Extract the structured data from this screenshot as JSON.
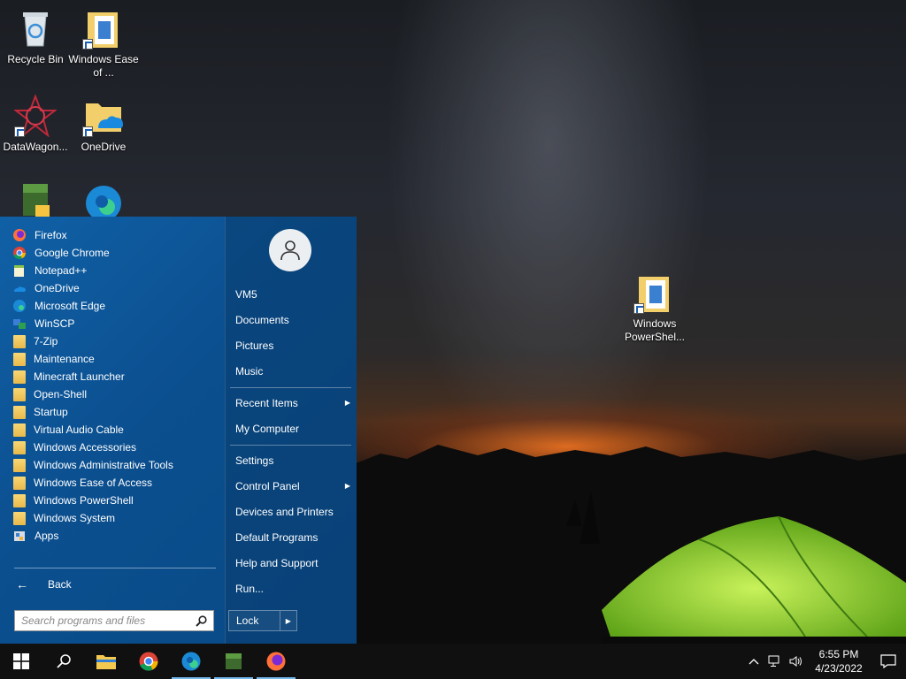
{
  "desktop": {
    "icons": [
      {
        "label": "Recycle Bin",
        "icon": "recycle-bin-icon"
      },
      {
        "label": "Windows Ease of ...",
        "icon": "folder-shortcut-icon"
      },
      {
        "label": "DataWagon...",
        "icon": "datawagon-icon"
      },
      {
        "label": "OneDrive",
        "icon": "onedrive-folder-icon"
      },
      {
        "label": "Windows PowerShel...",
        "icon": "folder-shortcut-icon"
      }
    ]
  },
  "start_menu": {
    "programs": [
      {
        "label": "Firefox",
        "icon": "firefox-icon"
      },
      {
        "label": "Google Chrome",
        "icon": "chrome-icon"
      },
      {
        "label": "Notepad++",
        "icon": "notepadpp-icon"
      },
      {
        "label": "OneDrive",
        "icon": "onedrive-icon"
      },
      {
        "label": "Microsoft Edge",
        "icon": "edge-icon"
      },
      {
        "label": "WinSCP",
        "icon": "winscp-icon"
      },
      {
        "label": "7-Zip",
        "icon": "folder-icon"
      },
      {
        "label": "Maintenance",
        "icon": "folder-icon"
      },
      {
        "label": "Minecraft Launcher",
        "icon": "folder-icon"
      },
      {
        "label": "Open-Shell",
        "icon": "folder-icon"
      },
      {
        "label": "Startup",
        "icon": "folder-icon"
      },
      {
        "label": "Virtual Audio Cable",
        "icon": "folder-icon"
      },
      {
        "label": "Windows Accessories",
        "icon": "folder-icon"
      },
      {
        "label": "Windows Administrative Tools",
        "icon": "folder-icon"
      },
      {
        "label": "Windows Ease of Access",
        "icon": "folder-icon"
      },
      {
        "label": "Windows PowerShell",
        "icon": "folder-icon"
      },
      {
        "label": "Windows System",
        "icon": "folder-icon"
      },
      {
        "label": "Apps",
        "icon": "apps-icon"
      }
    ],
    "back_label": "Back",
    "search_placeholder": "Search programs and files",
    "right": {
      "user": "VM5",
      "documents": "Documents",
      "pictures": "Pictures",
      "music": "Music",
      "recent_items": "Recent Items",
      "my_computer": "My Computer",
      "settings": "Settings",
      "control_panel": "Control Panel",
      "devices_printers": "Devices and Printers",
      "default_programs": "Default Programs",
      "help_support": "Help and Support",
      "run": "Run..."
    },
    "lock_label": "Lock"
  },
  "taskbar": {
    "pinned": [
      "start-icon",
      "search-icon",
      "file-explorer-icon",
      "chrome-icon",
      "edge-icon",
      "minecraft-icon",
      "firefox-icon"
    ],
    "time": "6:55 PM",
    "date": "4/23/2022"
  },
  "colors": {
    "start_menu_bg": "#0d4f8c",
    "taskbar_bg": "#101010",
    "active_indicator": "#76b9ed"
  }
}
